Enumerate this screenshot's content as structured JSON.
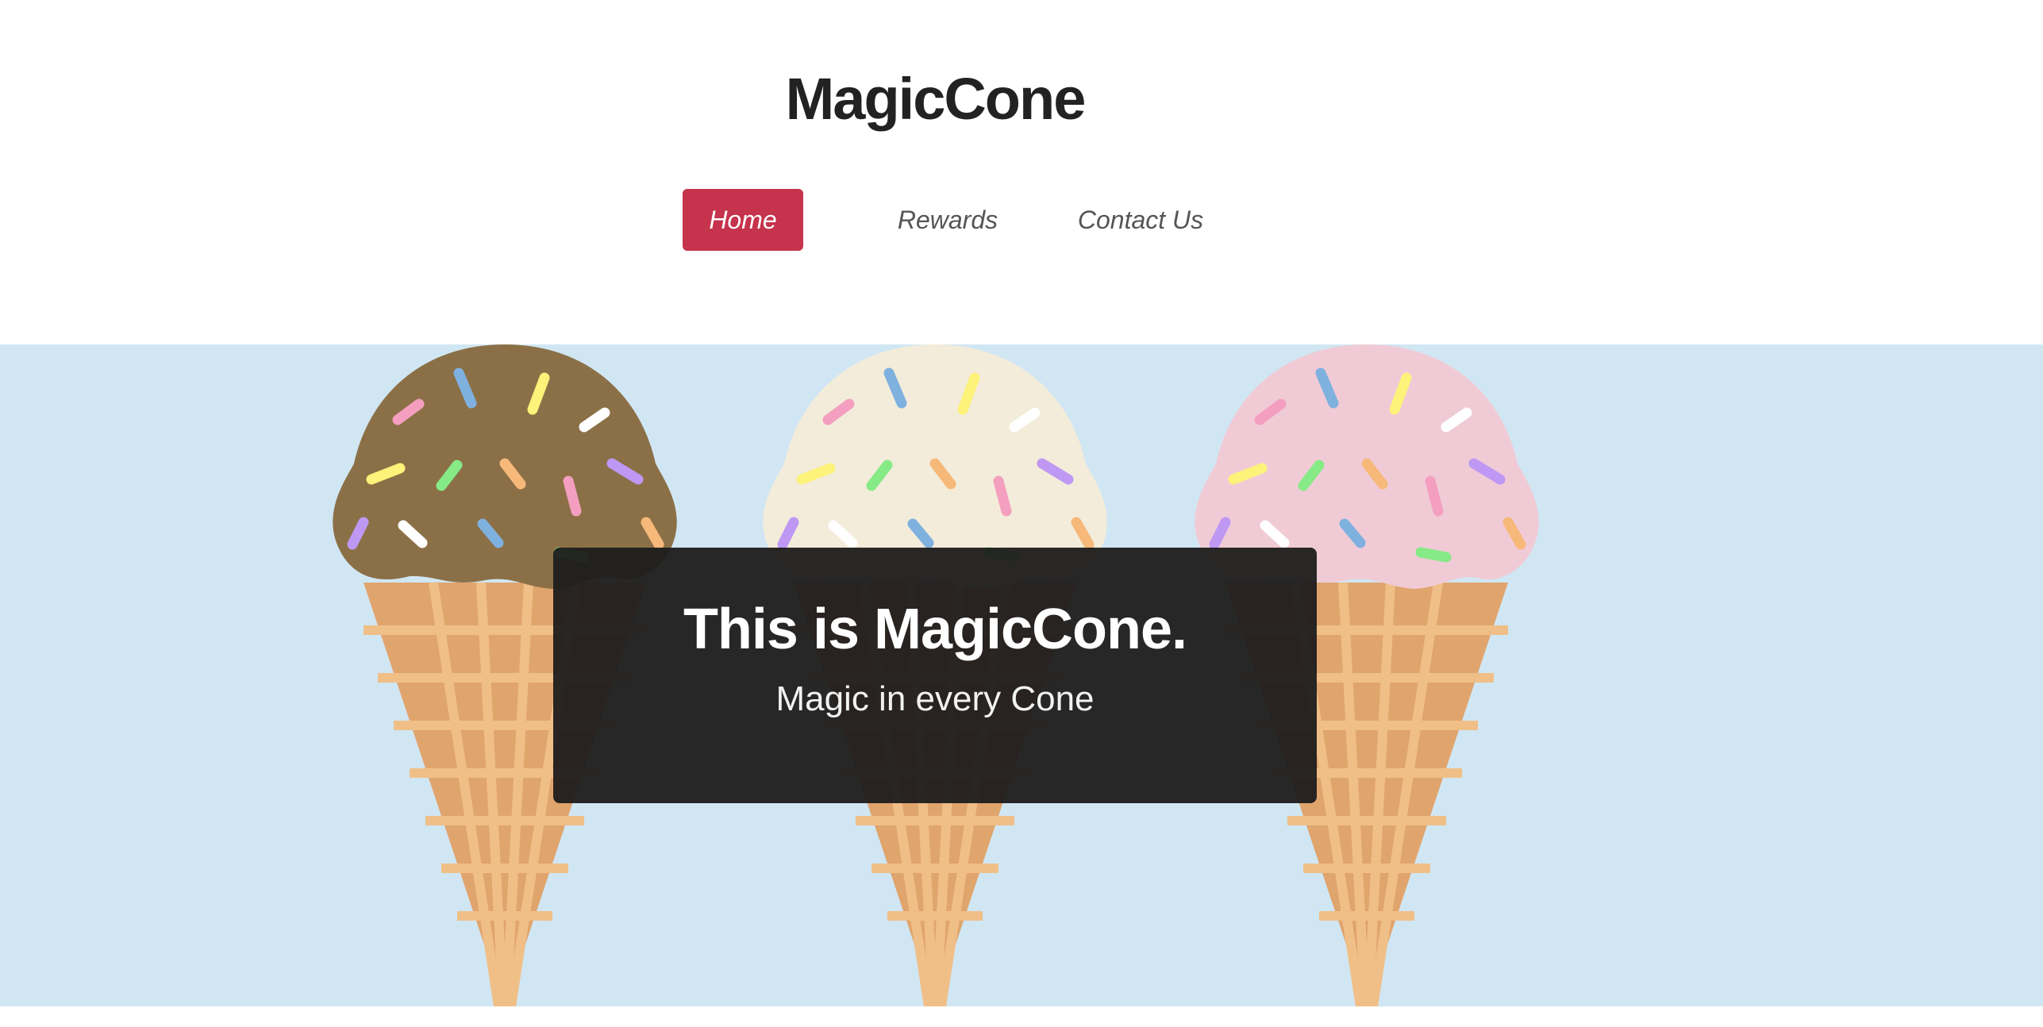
{
  "header": {
    "brand": "MagicCone"
  },
  "nav": {
    "items": [
      {
        "label": "Home",
        "active": true
      },
      {
        "label": "Rewards",
        "active": false
      },
      {
        "label": "Contact Us",
        "active": false
      }
    ]
  },
  "hero": {
    "title": "This is MagicCone.",
    "subtitle": "Magic in every Cone",
    "illustration": [
      {
        "flavor": "chocolate",
        "icon": "ice-cream-cone-icon"
      },
      {
        "flavor": "vanilla",
        "icon": "ice-cream-cone-icon"
      },
      {
        "flavor": "strawberry",
        "icon": "ice-cream-cone-icon"
      }
    ]
  },
  "colors": {
    "accent": "#c6334c",
    "hero_background": "#d1e6f3",
    "card_background": "#252222",
    "cone": "#e0a46d",
    "cone_grid": "#f0bf87",
    "chocolate": "#8b7047",
    "vanilla": "#f3ecda",
    "strawberry": "#f0cbd6"
  }
}
